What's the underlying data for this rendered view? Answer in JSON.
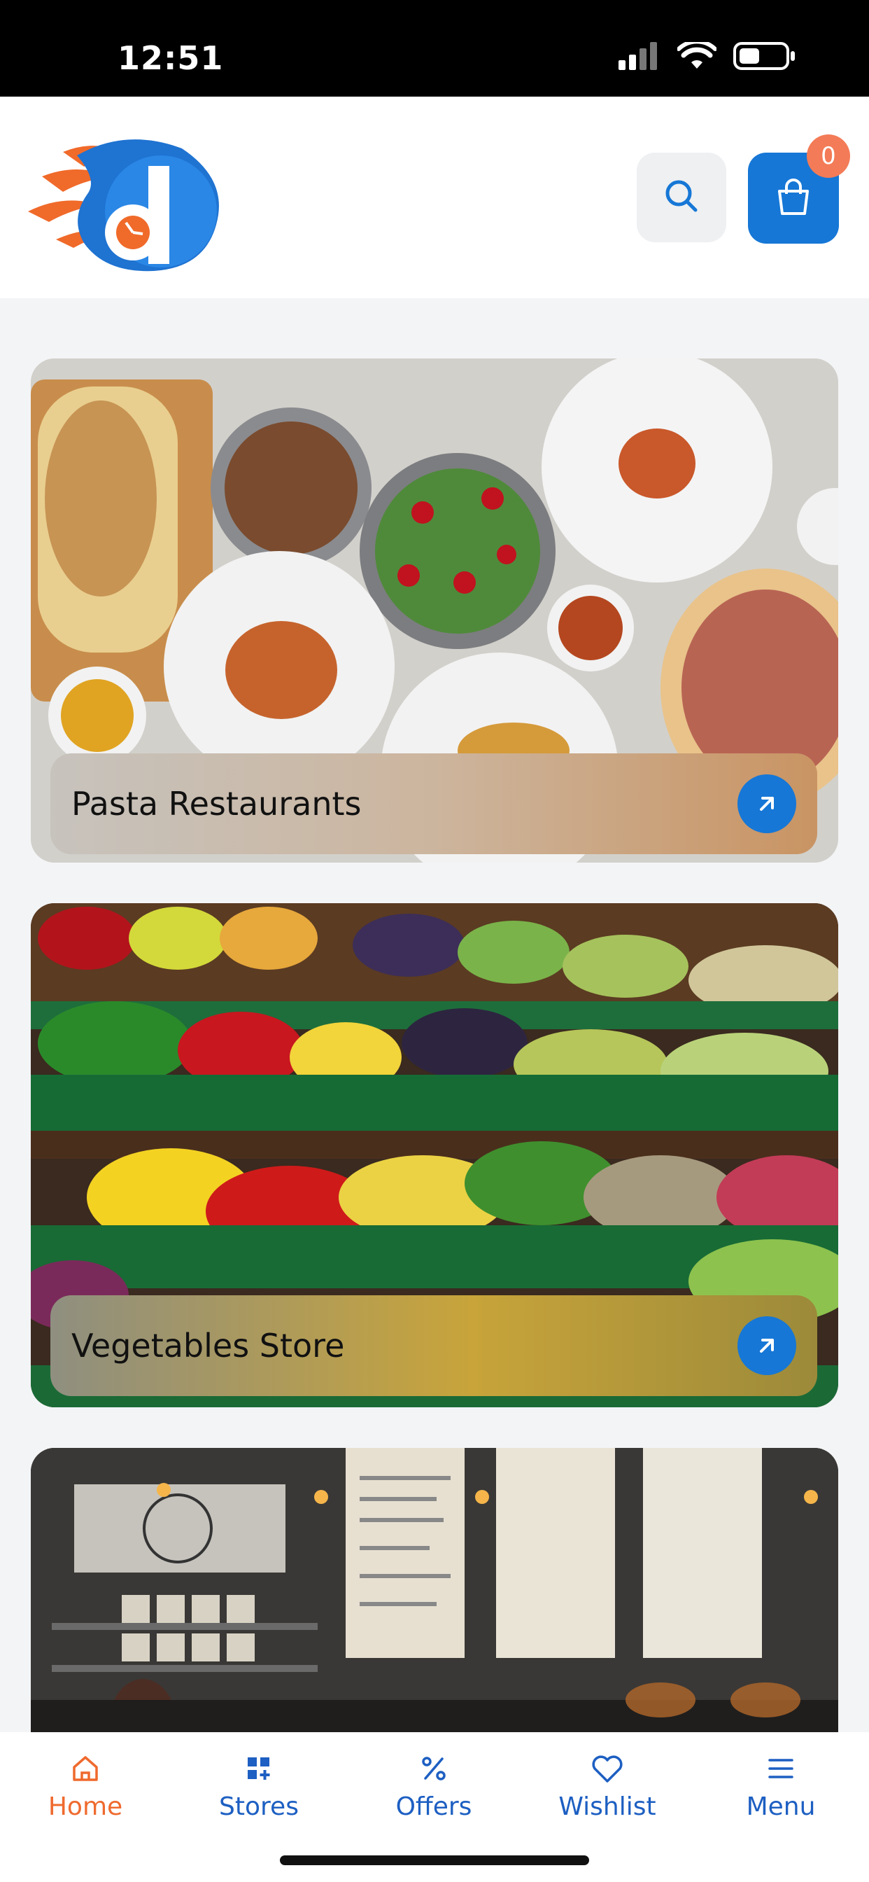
{
  "status_bar": {
    "time": "12:51",
    "signal_icon": "signal-icon",
    "wifi_icon": "wifi-icon",
    "battery_icon": "battery-icon"
  },
  "header": {
    "logo_icon": "brand-logo-d",
    "search_icon": "search-icon",
    "cart_icon": "shopping-bag-icon",
    "cart_count": "0"
  },
  "cards": [
    {
      "title": "Pasta Restaurants",
      "arrow_icon": "arrow-up-right-icon"
    },
    {
      "title": "Vegetables Store",
      "arrow_icon": "arrow-up-right-icon"
    },
    {
      "title": "",
      "image": "cafe-interior"
    }
  ],
  "bottom_nav": {
    "items": [
      {
        "label": "Home",
        "icon": "home-icon",
        "active": true
      },
      {
        "label": "Stores",
        "icon": "grid-plus-icon",
        "active": false
      },
      {
        "label": "Offers",
        "icon": "percent-icon",
        "active": false
      },
      {
        "label": "Wishlist",
        "icon": "heart-icon",
        "active": false
      },
      {
        "label": "Menu",
        "icon": "hamburger-icon",
        "active": false
      }
    ]
  },
  "colors": {
    "accent": "#1677d6",
    "active_nav": "#ef6a2e",
    "badge": "#f37b57"
  }
}
